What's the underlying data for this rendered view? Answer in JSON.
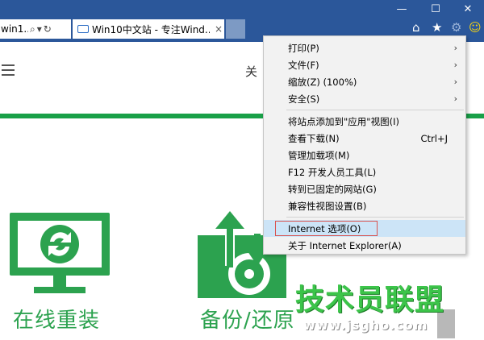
{
  "browser": {
    "address_text": "win1...",
    "active_tab_title": "Win10中文站 - 专注Wind...",
    "tab_close": "×",
    "window_controls": {
      "minimize": "—",
      "maximize": "☐",
      "close": "✕"
    },
    "toolbar_icons": [
      "home-icon",
      "favorites-star-icon",
      "settings-gear-icon",
      "smiley-feedback-icon"
    ]
  },
  "page": {
    "nav_partial": "关",
    "tiles": [
      {
        "label": "在线重装",
        "icon": "monitor-refresh-icon"
      },
      {
        "label": "备份/还原",
        "icon": "backup-disk-icon"
      }
    ],
    "watermark_title": "技术员联盟",
    "watermark_url": "www.jsgho.com"
  },
  "menu": {
    "items": [
      {
        "label": "打印(P)",
        "submenu": true
      },
      {
        "label": "文件(F)",
        "submenu": true
      },
      {
        "label": "缩放(Z) (100%)",
        "submenu": true
      },
      {
        "label": "安全(S)",
        "submenu": true
      },
      {
        "label": "将站点添加到\"应用\"视图(I)"
      },
      {
        "label": "查看下载(N)",
        "shortcut": "Ctrl+J"
      },
      {
        "label": "管理加载项(M)"
      },
      {
        "label": "F12 开发人员工具(L)"
      },
      {
        "label": "转到已固定的网站(G)"
      },
      {
        "label": "兼容性视图设置(B)"
      },
      {
        "label": "Internet 选项(O)",
        "highlighted": true
      },
      {
        "label": "关于 Internet Explorer(A)"
      }
    ],
    "arrow_glyph": "›"
  },
  "colors": {
    "titlebar": "#2b579a",
    "accent_green": "#19a048",
    "highlight": "#cce4f7",
    "highlight_border": "#d9534f"
  }
}
